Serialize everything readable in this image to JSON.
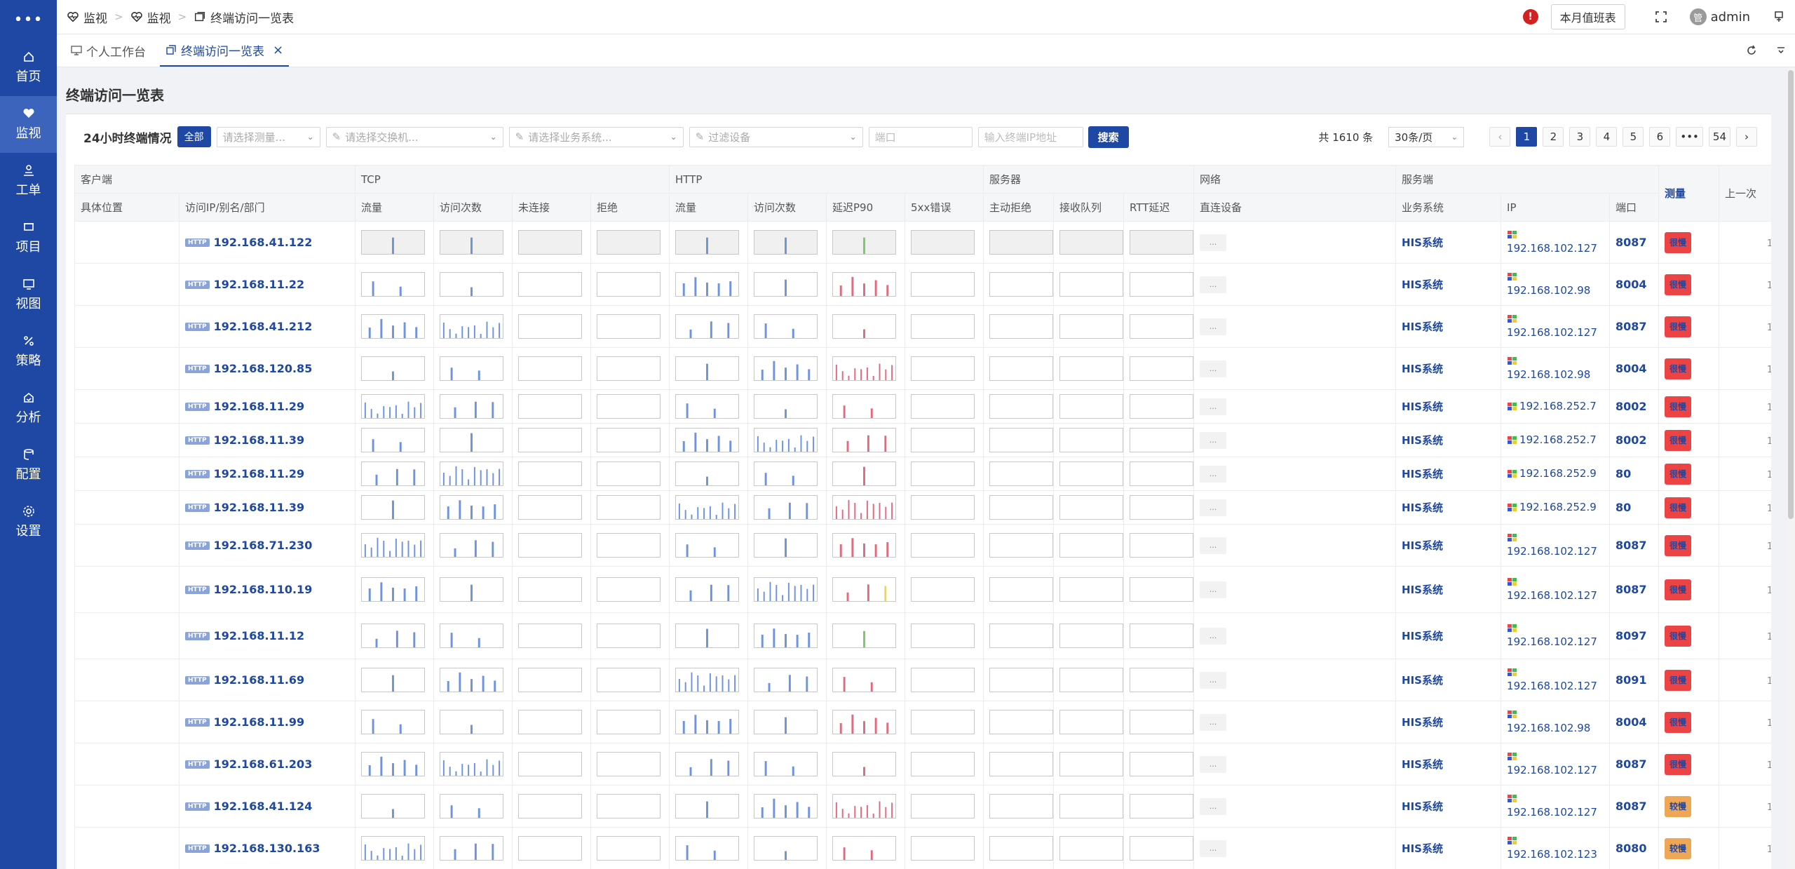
{
  "sidebar": {
    "items": [
      {
        "label": "首页",
        "icon": "home-icon"
      },
      {
        "label": "监视",
        "icon": "heart-monitor-icon",
        "active": true
      },
      {
        "label": "工单",
        "icon": "user-ticket-icon"
      },
      {
        "label": "项目",
        "icon": "project-icon"
      },
      {
        "label": "视图",
        "icon": "view-icon"
      },
      {
        "label": "策略",
        "icon": "strategy-icon"
      },
      {
        "label": "分析",
        "icon": "analysis-icon"
      },
      {
        "label": "配置",
        "icon": "config-icon"
      },
      {
        "label": "设置",
        "icon": "settings-icon"
      }
    ]
  },
  "breadcrumb": [
    "监视",
    "监视",
    "终端访问一览表"
  ],
  "topbar": {
    "duty_label": "本月值班表",
    "user": "admin",
    "avatar_text": "管",
    "alert": "!"
  },
  "tabs": [
    {
      "label": "个人工作台",
      "active": false
    },
    {
      "label": "终端访问一览表",
      "active": true
    }
  ],
  "page_title": "终端访问一览表",
  "filters": {
    "title": "24小时终端情况",
    "all_label": "全部",
    "measure_placeholder": "请选择测量...",
    "switch_placeholder": "请选择交换机...",
    "biz_placeholder": "请选择业务系统...",
    "device_placeholder": "过滤设备",
    "port_placeholder": "端口",
    "ip_placeholder": "输入终端IP地址",
    "search_label": "搜索"
  },
  "pagination": {
    "total": "共 1610 条",
    "page_size": "30条/页",
    "pages": [
      "1",
      "2",
      "3",
      "4",
      "5",
      "6",
      "•••",
      "54"
    ],
    "current": "1"
  },
  "table": {
    "group_headers": [
      "客户端",
      "TCP",
      "HTTP",
      "服务器",
      "网络",
      "服务端",
      "测量",
      "上一次"
    ],
    "columns": [
      "具体位置",
      "访问IP/别名/部门",
      "流量",
      "访问次数",
      "未连接",
      "拒绝",
      "流量",
      "访问次数",
      "延迟P90",
      "5xx错误",
      "主动拒绝",
      "接收队列",
      "RTT延迟",
      "直连设备",
      "业务系统",
      "IP",
      "端口"
    ],
    "rows": [
      {
        "ip": "192.168.41.122",
        "sys": "HIS系统",
        "srv_ip": "192.168.102.127",
        "port": "8087",
        "status": "很慢",
        "tag": "HTTP",
        "more": "..."
      },
      {
        "ip": "192.168.11.22",
        "sys": "HIS系统",
        "srv_ip": "192.168.102.98",
        "port": "8004",
        "status": "很慢",
        "tag": "HTTP",
        "more": "..."
      },
      {
        "ip": "192.168.41.212",
        "sys": "HIS系统",
        "srv_ip": "192.168.102.127",
        "port": "8087",
        "status": "很慢",
        "tag": "HTTP",
        "more": "..."
      },
      {
        "ip": "192.168.120.85",
        "sys": "HIS系统",
        "srv_ip": "192.168.102.98",
        "port": "8004",
        "status": "很慢",
        "tag": "HTTP",
        "more": "..."
      },
      {
        "ip": "192.168.11.29",
        "sys": "HIS系统",
        "srv_ip": "192.168.252.7",
        "port": "8002",
        "status": "很慢",
        "tag": "HTTP",
        "more": "..."
      },
      {
        "ip": "192.168.11.39",
        "sys": "HIS系统",
        "srv_ip": "192.168.252.7",
        "port": "8002",
        "status": "很慢",
        "tag": "HTTP",
        "more": "..."
      },
      {
        "ip": "192.168.11.29",
        "sys": "HIS系统",
        "srv_ip": "192.168.252.9",
        "port": "80",
        "status": "很慢",
        "tag": "HTTP",
        "more": "..."
      },
      {
        "ip": "192.168.11.39",
        "sys": "HIS系统",
        "srv_ip": "192.168.252.9",
        "port": "80",
        "status": "很慢",
        "tag": "HTTP",
        "more": "..."
      },
      {
        "ip": "192.168.71.230",
        "sys": "HIS系统",
        "srv_ip": "192.168.102.127",
        "port": "8087",
        "status": "很慢",
        "tag": "HTTP",
        "more": "..."
      },
      {
        "ip": "192.168.110.19",
        "sys": "HIS系统",
        "srv_ip": "192.168.102.127",
        "port": "8087",
        "status": "很慢",
        "tag": "HTTP",
        "more": "..."
      },
      {
        "ip": "192.168.11.12",
        "sys": "HIS系统",
        "srv_ip": "192.168.102.127",
        "port": "8097",
        "status": "很慢",
        "tag": "HTTP",
        "more": "..."
      },
      {
        "ip": "192.168.11.69",
        "sys": "HIS系统",
        "srv_ip": "192.168.102.127",
        "port": "8091",
        "status": "很慢",
        "tag": "HTTP",
        "more": "..."
      },
      {
        "ip": "192.168.11.99",
        "sys": "HIS系统",
        "srv_ip": "192.168.102.98",
        "port": "8004",
        "status": "很慢",
        "tag": "HTTP",
        "more": "..."
      },
      {
        "ip": "192.168.61.203",
        "sys": "HIS系统",
        "srv_ip": "192.168.102.127",
        "port": "8087",
        "status": "很慢",
        "tag": "HTTP",
        "more": "..."
      },
      {
        "ip": "192.168.41.124",
        "sys": "HIS系统",
        "srv_ip": "192.168.102.127",
        "port": "8087",
        "status": "较慢",
        "tag": "HTTP",
        "more": "..."
      },
      {
        "ip": "192.168.130.163",
        "sys": "HIS系统",
        "srv_ip": "192.168.102.123",
        "port": "8080",
        "status": "较慢",
        "tag": "HTTP",
        "more": "..."
      }
    ],
    "last_col_value": "1"
  },
  "colors": {
    "brand": "#1e48a3",
    "tcp_bar": "#6f93dd",
    "latency_bar": "#e26a7e",
    "good_bar": "#7cc96a",
    "warn_bar": "#e9d65a",
    "status_red": "#ec4444",
    "status_orange": "#eea657"
  }
}
